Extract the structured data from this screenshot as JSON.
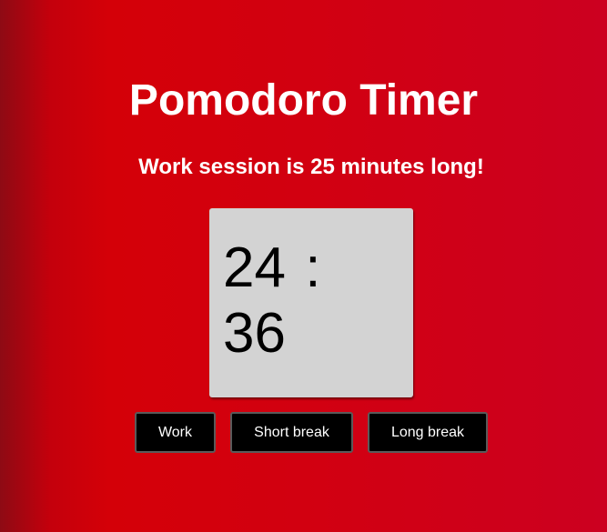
{
  "app": {
    "title": "Pomodoro Timer",
    "subtitle": "Work session is 25 minutes long!"
  },
  "timer": {
    "display": "24 : 36",
    "minutes": "24",
    "seconds": "36"
  },
  "buttons": {
    "work_label": "Work",
    "short_break_label": "Short break",
    "long_break_label": "Long break"
  },
  "colors": {
    "background": "#d20010",
    "timer_box": "#d3d3d3",
    "button_bg": "#000000",
    "text": "#ffffff"
  }
}
